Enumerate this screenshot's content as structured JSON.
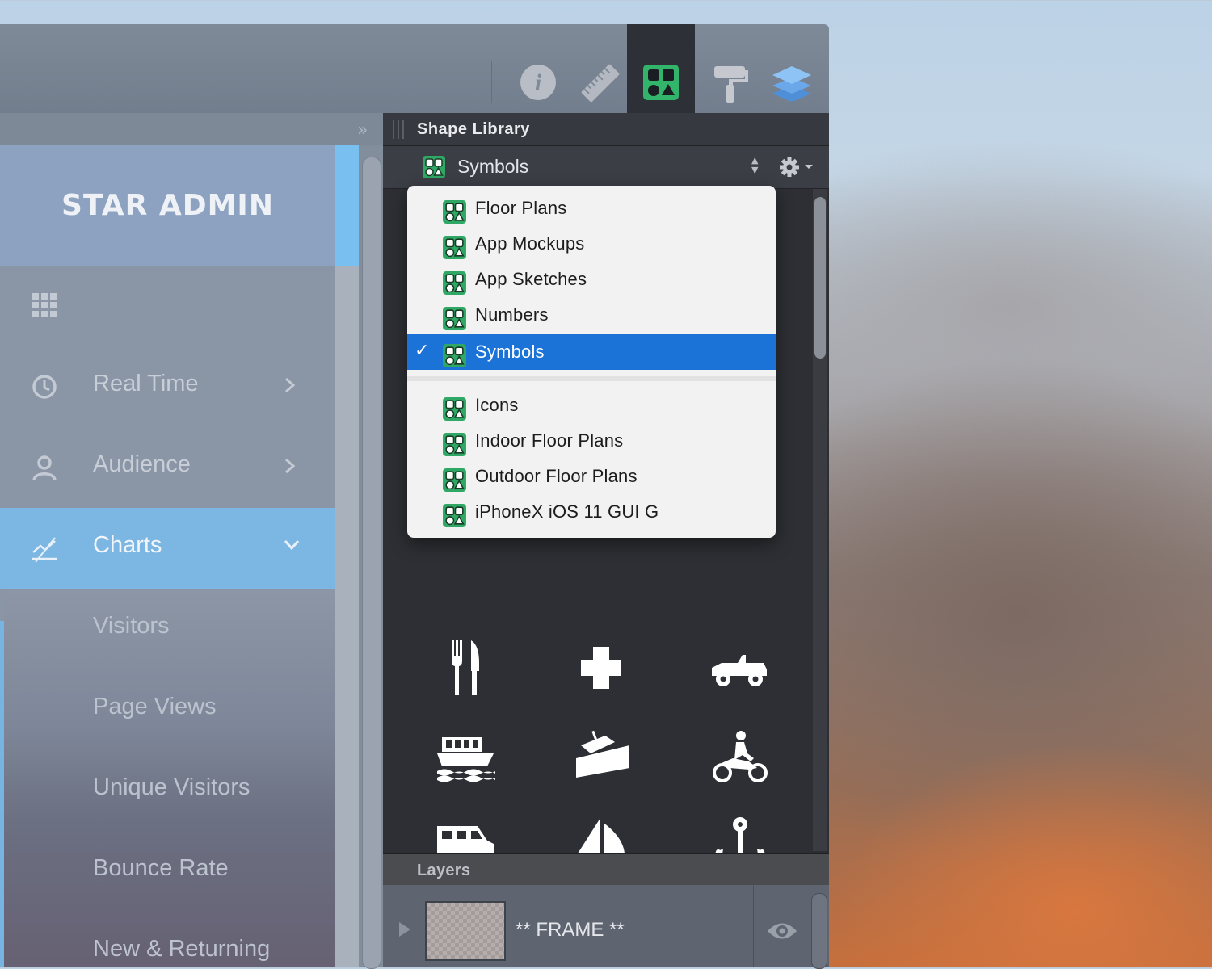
{
  "toolbar": {
    "buttons": [
      {
        "icon": "info-icon",
        "active": false
      },
      {
        "icon": "ruler-icon",
        "active": false
      },
      {
        "icon": "shapes-icon",
        "active": true
      },
      {
        "icon": "paint-roller-icon",
        "active": false
      },
      {
        "icon": "layers-stack-icon",
        "active": false
      }
    ]
  },
  "sidebar": {
    "brand": "STAR ADMIN",
    "items": [
      {
        "label": "Real Time",
        "icon": "clock-icon"
      },
      {
        "label": "Audience",
        "icon": "user-icon"
      },
      {
        "label": "Charts",
        "icon": "chart-line-icon",
        "active": true
      }
    ],
    "subitems": [
      "Visitors",
      "Page Views",
      "Unique Visitors",
      "Bounce Rate",
      "New & Returning"
    ]
  },
  "panel": {
    "title": "Shape Library",
    "selected_library": "Symbols",
    "menu": {
      "group1": [
        "Floor Plans",
        "App Mockups",
        "App Sketches",
        "Numbers",
        "Symbols"
      ],
      "group2": [
        "Icons",
        "Indoor Floor Plans",
        "Outdoor Floor Plans",
        "iPhoneX iOS 11 GUI G"
      ],
      "selected": "Symbols",
      "check": "✓"
    },
    "symbols": [
      "fork-knife-icon",
      "medical-cross-icon",
      "jeep-icon",
      "ferry-icon",
      "boat-ramp-icon",
      "motorcycle-icon",
      "camper-van-icon",
      "sailboat-icon",
      "anchor-icon"
    ],
    "add_label": "+"
  },
  "layers": {
    "title": "Layers",
    "rows": [
      {
        "name": "** FRAME **",
        "visible": true
      }
    ]
  },
  "colors": {
    "accent": "#1b73d8",
    "active_nav": "#7cb6e2",
    "shape_icon_green": "#2fa865"
  }
}
